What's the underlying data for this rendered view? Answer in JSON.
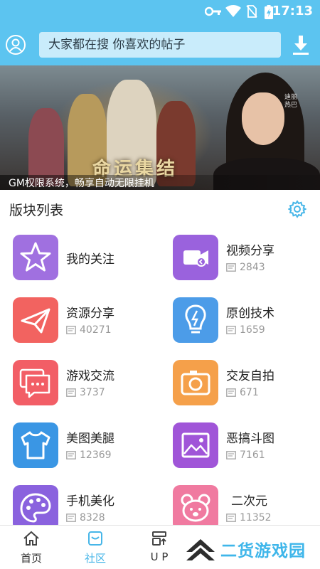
{
  "status": {
    "time": "17:13"
  },
  "header": {
    "search_text": "大家都在搜  你喜欢的帖子"
  },
  "banner": {
    "caption": "GM权限系统，畅享自动无限挂机",
    "logo_text": "命运集结",
    "side_text": "迪丽热巴"
  },
  "section": {
    "title": "版块列表"
  },
  "colors": {
    "header_bg": "#5cc4f0",
    "accent": "#47b6e8"
  },
  "forums": [
    {
      "name": "我的关注",
      "count": "",
      "icon": "star-icon"
    },
    {
      "name": "视频分享",
      "count": "2843",
      "icon": "video-camera-icon"
    },
    {
      "name": "资源分享",
      "count": "40271",
      "icon": "paper-plane-icon"
    },
    {
      "name": "原创技术",
      "count": "1659",
      "icon": "lightbulb-icon"
    },
    {
      "name": "游戏交流",
      "count": "3737",
      "icon": "chat-bubbles-icon"
    },
    {
      "name": "交友自拍",
      "count": "671",
      "icon": "camera-icon"
    },
    {
      "name": "美图美腿",
      "count": "12369",
      "icon": "tshirt-icon"
    },
    {
      "name": "恶搞斗图",
      "count": "7161",
      "icon": "picture-icon"
    },
    {
      "name": "手机美化",
      "count": "8328",
      "icon": "palette-icon"
    },
    {
      "name": "二次元",
      "count": "11352",
      "icon": "bear-face-icon"
    }
  ],
  "nav": [
    {
      "label": "首页",
      "icon": "home-icon"
    },
    {
      "label": "社区",
      "icon": "community-icon"
    },
    {
      "label": "U P",
      "icon": "upload-icon"
    }
  ],
  "watermark": {
    "text": "二货游戏园"
  }
}
